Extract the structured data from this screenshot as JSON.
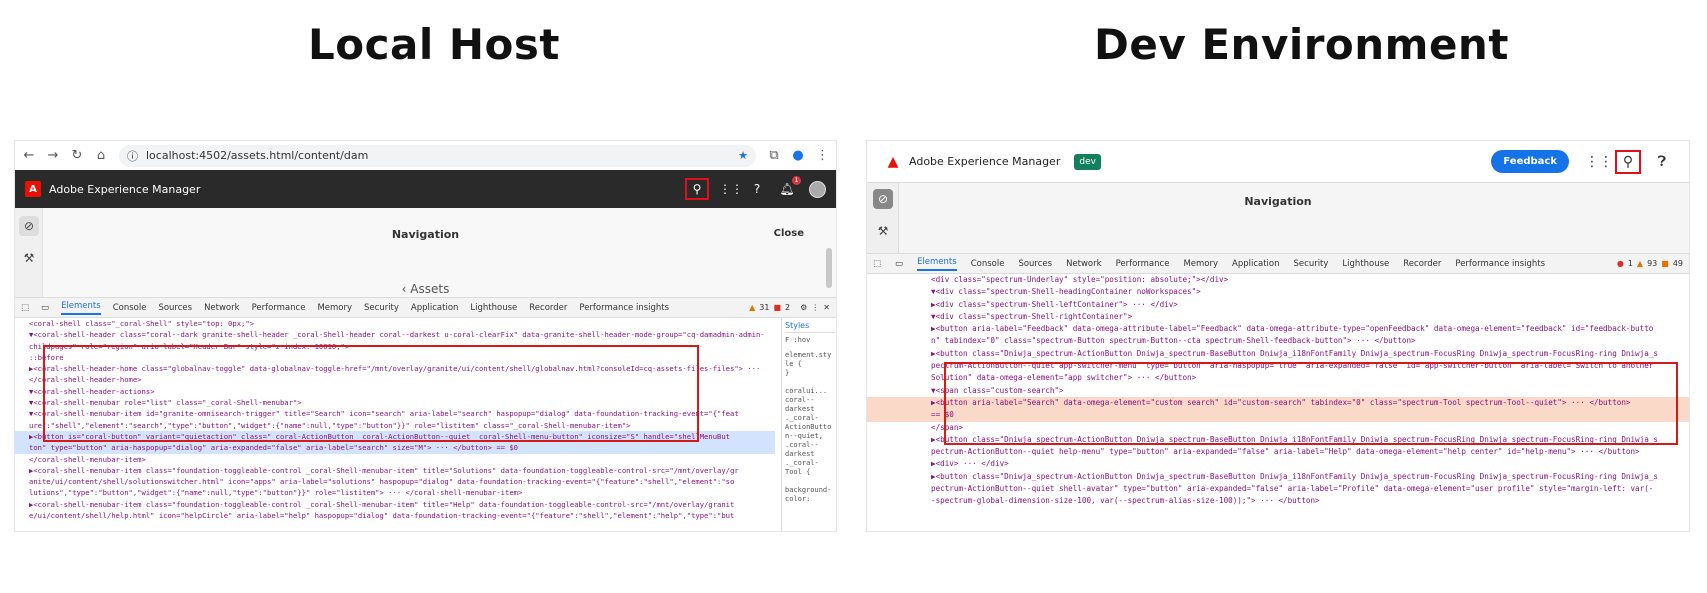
{
  "headings": {
    "left": "Local Host",
    "right": "Dev Environment"
  },
  "left": {
    "url": "localhost:4502/assets.html/content/dam",
    "app_title": "Adobe Experience Manager",
    "notification_count": "1",
    "nav_title": "Navigation",
    "nav_close": "Close",
    "nav_assets": "‹  Assets",
    "tabs": [
      "Elements",
      "Console",
      "Sources",
      "Network",
      "Performance",
      "Memory",
      "Security",
      "Application",
      "Lighthouse",
      "Recorder",
      "Performance insights"
    ],
    "warning_count": "31",
    "error_count": "2",
    "styles_label": "Styles",
    "styles_filter": "F  :hov",
    "styles_lines": [
      "element.sty",
      "le {",
      "}",
      "",
      "coralui...",
      "coral--",
      "darkest",
      "._coral-",
      "ActionButto",
      "n--quiet,",
      ".coral--",
      "darkest",
      "._coral-",
      "Tool {",
      "",
      "background-",
      "color:"
    ],
    "dom": [
      "<coral-shell class=\"_coral-Shell\" style=\"top: 0px;\">",
      "▼<coral-shell-header class=\"coral--dark granite-shell-header _coral-Shell-header coral--darkest u-coral-clearFix\" data-granite-shell-header-mode-group=\"cq-damadmin-admin-",
      "  childpages\" role=\"region\" aria-label=\"Header Bar\" style=\"z-index: 10010;\">",
      "   ::before",
      "  ▶<coral-shell-header-home class=\"globalnav-toggle\" data-globalnav-toggle-href=\"/mnt/overlay/granite/ui/content/shell/globalnav.html?consoleId=cq-assets-files-files\"> ···",
      "   </coral-shell-header-home>",
      " ▼<coral-shell-header-actions>",
      "   ▼<coral-shell-menubar role=\"list\" class=\"_coral-Shell-menubar\">",
      "     ▼<coral-shell-menubar-item id=\"granite-omnisearch-trigger\" title=\"Search\" icon=\"search\" aria-label=\"search\" haspopup=\"dialog\" data-foundation-tracking-event=\"{\"feat",
      "       ure\":\"shell\",\"element\":\"search\",\"type\":\"button\",\"widget\":{\"name\":null,\"type\":\"button\"}}\" role=\"listitem\" class=\"_coral-Shell-menubar-item\">",
      "       ▶<button is=\"coral-button\" variant=\"quietaction\" class=\"_coral-ActionButton _coral-ActionButton--quiet _coral-Shell-menu-button\" iconsize=\"S\" handle=\"shellMenuBut",
      "        ton\" type=\"button\" aria-haspopup=\"dialog\" aria-expanded=\"false\" aria-label=\"search\" size=\"M\"> ··· </button>  == $0",
      "      </coral-shell-menubar-item>",
      "     ▶<coral-shell-menubar-item class=\"foundation-toggleable-control _coral-Shell-menubar-item\" title=\"Solutions\" data-foundation-toggleable-control-src=\"/mnt/overlay/gr",
      "       anite/ui/content/shell/solutionswitcher.html\" icon=\"apps\" aria-label=\"solutions\" haspopup=\"dialog\" data-foundation-tracking-event=\"{\"feature\":\"shell\",\"element\":\"so",
      "       lutions\",\"type\":\"button\",\"widget\":{\"name\":null,\"type\":\"button\"}}\" role=\"listitem\"> ··· </coral-shell-menubar-item>",
      "     ▶<coral-shell-menubar-item class=\"foundation-toggleable-control _coral-Shell-menubar-item\" title=\"Help\" data-foundation-toggleable-control-src=\"/mnt/overlay/granit",
      "       e/ui/content/shell/help.html\" icon=\"helpCircle\" aria-label=\"help\" haspopup=\"dialog\" data-foundation-tracking-event=\"{\"feature\":\"shell\",\"element\":\"help\",\"type\":\"but"
    ]
  },
  "right": {
    "app_title": "Adobe Experience Manager",
    "env_badge": "dev",
    "feedback_label": "Feedback",
    "nav_title": "Navigation",
    "tabs": [
      "Elements",
      "Console",
      "Sources",
      "Network",
      "Performance",
      "Memory",
      "Application",
      "Security",
      "Lighthouse",
      "Recorder",
      "Performance insights"
    ],
    "error_count": "1",
    "warning_count": "93",
    "issue_count": "49",
    "dom": [
      "    <div class=\"spectrum-Underlay\" style=\"position: absolute;\"></div>",
      "   ▼<div class=\"spectrum-Shell-headingContainer noWorkspaces\">",
      "    ▶<div class=\"spectrum-Shell-leftContainer\"> ··· </div>",
      "    ▼<div class=\"spectrum-Shell-rightContainer\">",
      "      ▶<button aria-label=\"Feedback\" data-omega-attribute-label=\"Feedback\" data-omega-attribute-type=\"openFeedback\" data-omega-element=\"feedback\" id=\"feedback-butto",
      "       n\" tabindex=\"0\" class=\"spectrum-Button spectrum-Button--cta spectrum-Shell-feedback-button\"> ··· </button>",
      "      ▶<button class=\"Dniwja_spectrum-ActionButton Dniwja_spectrum-BaseButton Dniwja_i18nFontFamily Dniwja_spectrum-FocusRing Dniwja_spectrum-FocusRing-ring Dniwja_s",
      "       pectrum-ActionButton--quiet app-switcher-menu\" type=\"button\" aria-haspopup=\"true\" aria-expanded=\"false\" id=\"app-switcher-button\" aria-label=\"Switch to another",
      "       Solution\" data-omega-element=\"app switcher\"> ··· </button>",
      "      ▼<span class=\"custom-search\">",
      "       ▶<button aria-label=\"Search\" data-omega-element=\"custom search\" id=\"custom-search\" tabindex=\"0\" class=\"spectrum-Tool spectrum-Tool--quiet\"> ··· </button>",
      "         == $0",
      "       </span>",
      "      ▶<button class=\"Dniwja_spectrum-ActionButton Dniwja_spectrum-BaseButton Dniwja_i18nFontFamily Dniwja_spectrum-FocusRing Dniwja_spectrum-FocusRing-ring Dniwja_s",
      "       pectrum-ActionButton--quiet help-menu\" type=\"button\" aria-expanded=\"false\" aria-label=\"Help\" data-omega-element=\"help center\" id=\"help-menu\"> ··· </button>",
      "      ▶<div> ··· </div>",
      "      ▶<button class=\"Dniwja_spectrum-ActionButton Dniwja_spectrum-BaseButton Dniwja_i18nFontFamily Dniwja_spectrum-FocusRing Dniwja_spectrum-FocusRing-ring Dniwja_s",
      "       pectrum-ActionButton--quiet shell-avatar\" type=\"button\" aria-expanded=\"false\" aria-label=\"Profile\" data-omega-element=\"user profile\" style=\"margin-left: var(-",
      "       -spectrum-global-dimension-size-100, var(--spectrum-alias-size-100));\"> ··· </button>"
    ]
  },
  "colors": {
    "highlight": "#d51a1a",
    "accent": "#1473e6",
    "dev_badge": "#12805c"
  }
}
